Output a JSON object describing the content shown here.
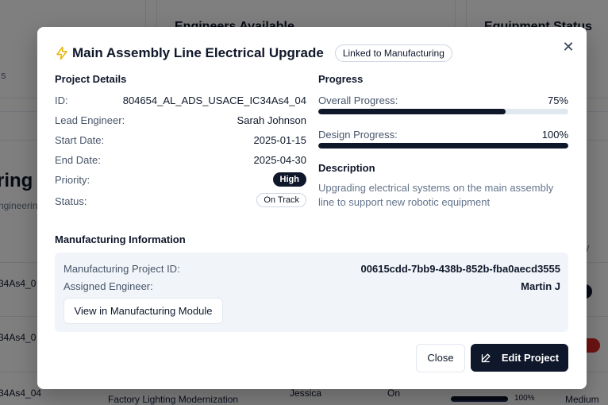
{
  "background": {
    "card_titles": [
      "Engineers Available",
      "Equipment Status"
    ],
    "side_text": [
      "s",
      "ring P",
      "ngineering"
    ],
    "row_ids": [
      "34As4_0",
      "34As4_0",
      "34As4_04"
    ],
    "bottom_row": {
      "project": "Factory Lighting Modernization",
      "engineer": "Jessica",
      "status": "On",
      "progress": "100%",
      "priority": "Medium"
    },
    "col_stub": "y"
  },
  "modal": {
    "title": "Main Assembly Line Electrical Upgrade",
    "link_badge": "Linked to Manufacturing",
    "close_icon": "close-icon",
    "title_icon": "bolt-icon",
    "project_details": {
      "heading": "Project Details",
      "rows": [
        {
          "label": "ID:",
          "value": "804654_AL_ADS_USACE_IC34As4_04"
        },
        {
          "label": "Lead Engineer:",
          "value": "Sarah Johnson"
        },
        {
          "label": "Start Date:",
          "value": "2025-01-15"
        },
        {
          "label": "End Date:",
          "value": "2025-04-30"
        },
        {
          "label": "Priority:",
          "value": "High"
        },
        {
          "label": "Status:",
          "value": "On Track"
        }
      ]
    },
    "progress": {
      "heading": "Progress",
      "items": [
        {
          "label": "Overall Progress:",
          "value": "75%",
          "fraction": 0.75
        },
        {
          "label": "Design Progress:",
          "value": "100%",
          "fraction": 1.0
        }
      ]
    },
    "description": {
      "heading": "Description",
      "text": "Upgrading electrical systems on the main assembly line to support new robotic equipment"
    },
    "manufacturing": {
      "heading": "Manufacturing Information",
      "project_id_label": "Manufacturing Project ID:",
      "project_id_value": "00615cdd-7bb9-438b-852b-fba0aecd3555",
      "engineer_label": "Assigned Engineer:",
      "engineer_value": "Martin J",
      "view_button": "View in Manufacturing Module"
    },
    "footer": {
      "close_button": "Close",
      "edit_button": "Edit Project",
      "edit_icon": "edit-icon"
    }
  },
  "colors": {
    "dark": "#0f172a",
    "muted": "#64748b",
    "track": "#e2e8f0",
    "panel": "#f1f5f9",
    "bolt": "#eab308"
  }
}
